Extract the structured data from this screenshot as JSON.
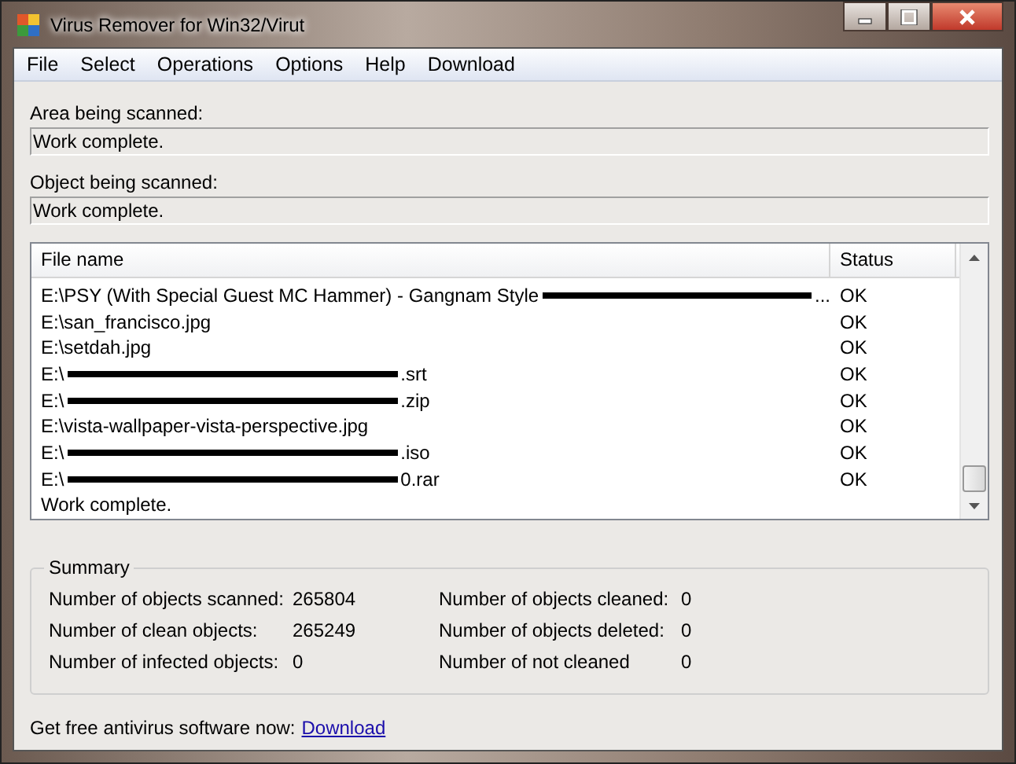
{
  "window": {
    "title": "Virus Remover for Win32/Virut"
  },
  "menu": [
    {
      "label": "File"
    },
    {
      "label": "Select"
    },
    {
      "label": "Operations"
    },
    {
      "label": "Options"
    },
    {
      "label": "Help"
    },
    {
      "label": "Download"
    }
  ],
  "area": {
    "label": "Area being scanned:",
    "value": "Work complete."
  },
  "object": {
    "label": "Object being scanned:",
    "value": "Work complete."
  },
  "file_list": {
    "columns": [
      "File name",
      "Status"
    ],
    "rows": [
      {
        "name": "E:\\PSY (With Special Guest MC Hammer) - Gangnam Style",
        "redacted": true,
        "suffix": "...",
        "status": "OK"
      },
      {
        "name": "E:\\san_francisco.jpg",
        "redacted": false,
        "status": "OK"
      },
      {
        "name": "E:\\setdah.jpg",
        "redacted": false,
        "status": "OK"
      },
      {
        "name": "E:\\",
        "redacted": true,
        "suffix": ".srt",
        "status": "OK"
      },
      {
        "name": "E:\\",
        "redacted": true,
        "suffix": ".zip",
        "status": "OK"
      },
      {
        "name": "E:\\vista-wallpaper-vista-perspective.jpg",
        "redacted": false,
        "status": "OK"
      },
      {
        "name": "E:\\",
        "redacted": true,
        "suffix": ".iso",
        "status": "OK"
      },
      {
        "name": "E:\\",
        "redacted": true,
        "suffix": "0.rar",
        "status": "OK"
      }
    ],
    "footer": "Work complete."
  },
  "summary": {
    "title": "Summary",
    "items": [
      {
        "label": "Number of objects scanned:",
        "value": "265804"
      },
      {
        "label": "Number of objects cleaned:",
        "value": "0"
      },
      {
        "label": "Number of clean objects:",
        "value": "265249"
      },
      {
        "label": "Number of objects deleted:",
        "value": "0"
      },
      {
        "label": "Number of infected objects:",
        "value": "0"
      },
      {
        "label": "Number of not cleaned",
        "value": "0"
      }
    ]
  },
  "promo": {
    "text": "Get free antivirus software now:",
    "link": "Download"
  }
}
